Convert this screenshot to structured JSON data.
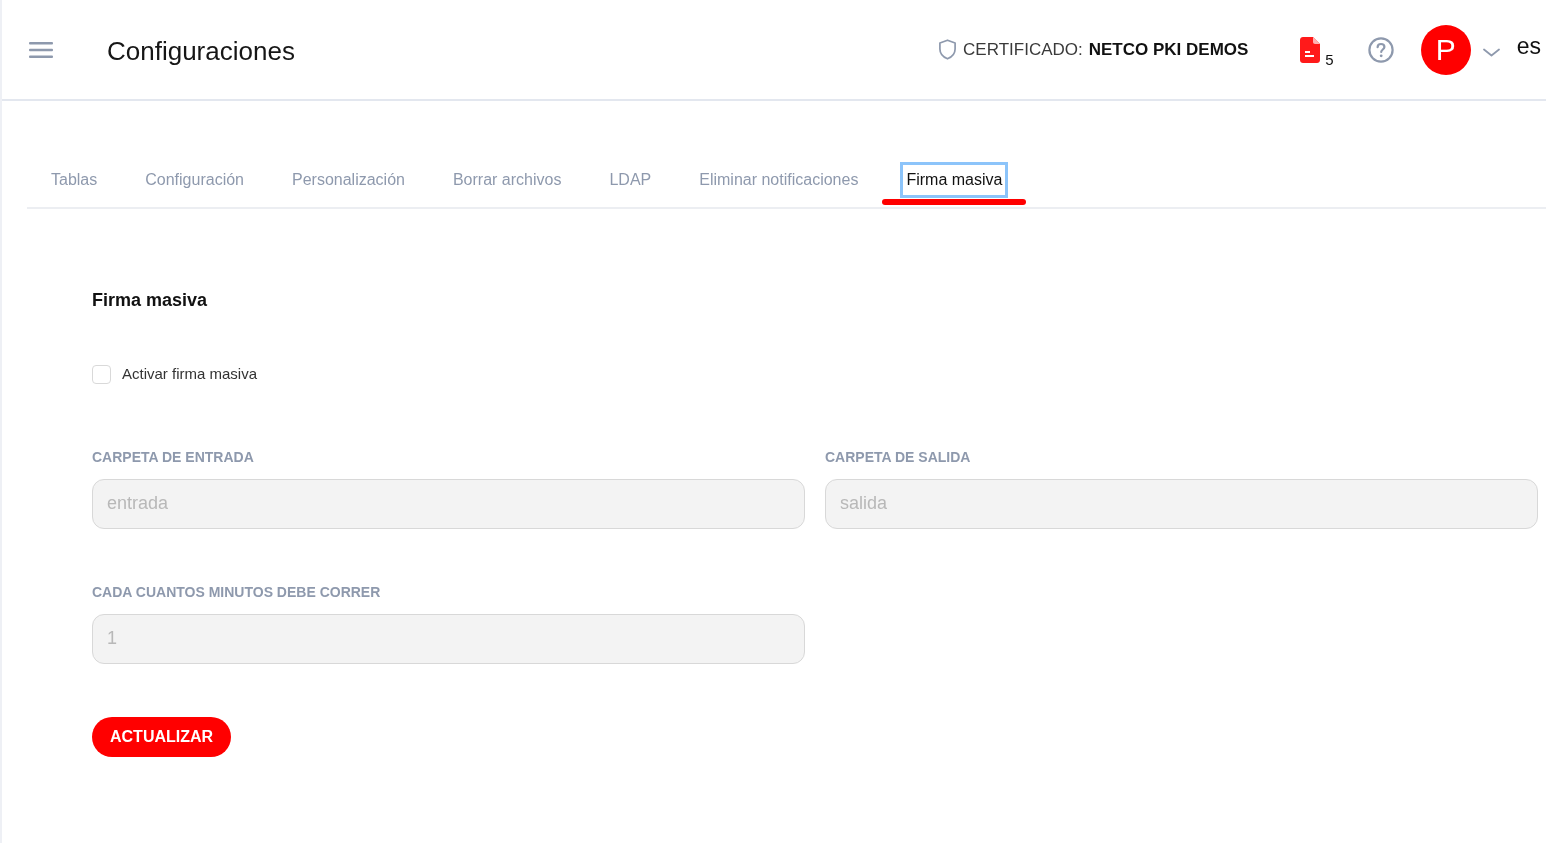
{
  "header": {
    "title": "Configuraciones",
    "certificate": {
      "label": "CERTIFICADO:",
      "value": "NETCO PKI DEMOS"
    },
    "documents_count": "5",
    "avatar_initial": "P",
    "language": "es"
  },
  "tabs": [
    {
      "label": "Tablas",
      "selected": false,
      "focused": false
    },
    {
      "label": "Configuración",
      "selected": false,
      "focused": false
    },
    {
      "label": "Personalización",
      "selected": false,
      "focused": false
    },
    {
      "label": "Borrar archivos",
      "selected": false,
      "focused": false
    },
    {
      "label": "LDAP",
      "selected": false,
      "focused": false
    },
    {
      "label": "Eliminar notificaciones",
      "selected": false,
      "focused": false
    },
    {
      "label": "Firma masiva",
      "selected": true,
      "focused": true
    }
  ],
  "section": {
    "title": "Firma masiva",
    "checkbox": {
      "label": "Activar firma masiva",
      "checked": false
    },
    "fields": [
      {
        "label": "CARPETA DE ENTRADA",
        "value": "entrada",
        "disabled": true
      },
      {
        "label": "CARPETA DE SALIDA",
        "value": "salida",
        "disabled": true
      },
      {
        "label": "CADA CUANTOS MINUTOS DEBE CORRER",
        "value": "1",
        "disabled": true
      }
    ],
    "button": "ACTUALIZAR"
  }
}
